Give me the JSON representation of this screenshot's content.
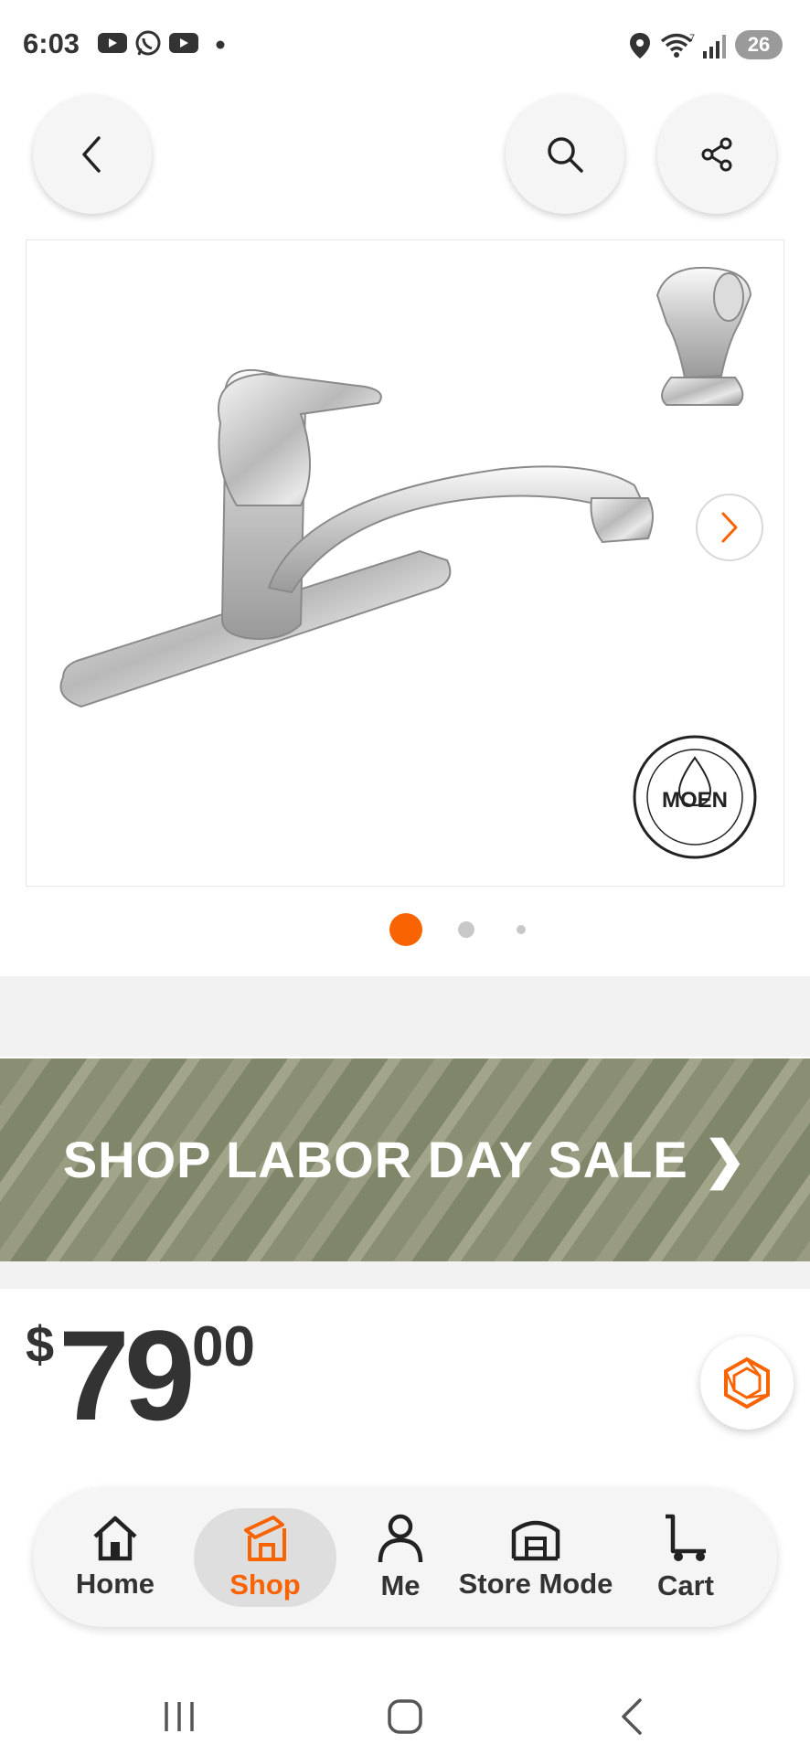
{
  "status_bar": {
    "time": "6:03",
    "battery": "26",
    "icons": [
      "youtube-icon",
      "whatsapp-icon",
      "youtube-icon",
      "notification-dot",
      "location-icon",
      "wifi-icon",
      "signal-icon",
      "battery-icon"
    ]
  },
  "top_nav": {
    "back_icon": "back-chevron-icon",
    "search_icon": "search-icon",
    "share_icon": "share-icon"
  },
  "product": {
    "image_alt": "Moen kitchen faucet with side sprayer",
    "logo_text": "MOEN",
    "carousel": {
      "total": 3,
      "active": 0
    }
  },
  "promo": {
    "text": "SHOP LABOR DAY SALE ❯"
  },
  "price": {
    "currency": "$",
    "whole": "79",
    "cents": "00"
  },
  "bottom_nav": {
    "items": [
      {
        "label": "Home",
        "icon": "home-icon"
      },
      {
        "label": "Shop",
        "icon": "shop-icon",
        "active": true
      },
      {
        "label": "Me",
        "icon": "person-icon"
      },
      {
        "label": "Store Mode",
        "icon": "store-icon"
      },
      {
        "label": "Cart",
        "icon": "cart-icon"
      }
    ]
  },
  "colors": {
    "accent": "#f96302",
    "promo_bg": "#8a8f73",
    "text": "#333333"
  }
}
